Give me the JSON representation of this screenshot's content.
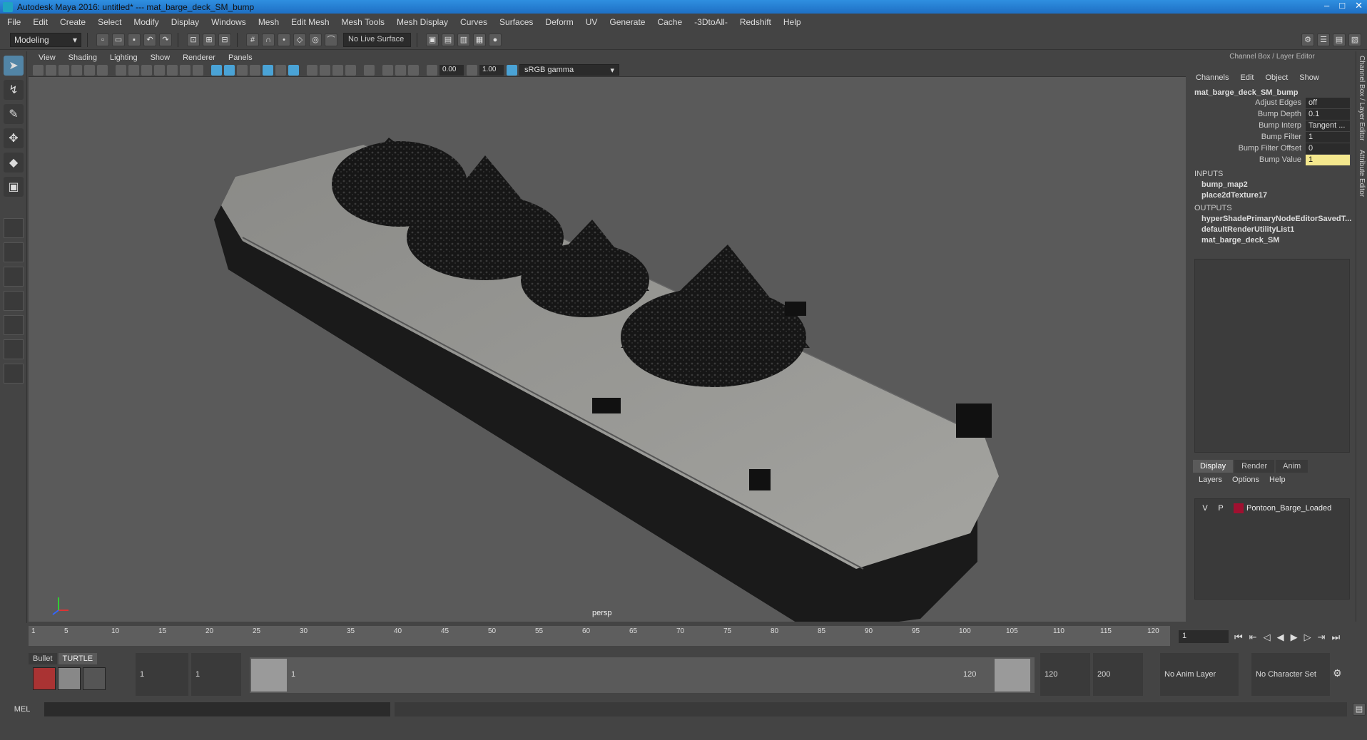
{
  "window": {
    "title": "Autodesk Maya 2016: untitled*   ---   mat_barge_deck_SM_bump",
    "min": "–",
    "max": "□",
    "close": "✕"
  },
  "menu": [
    "File",
    "Edit",
    "Create",
    "Select",
    "Modify",
    "Display",
    "Windows",
    "Mesh",
    "Edit Mesh",
    "Mesh Tools",
    "Mesh Display",
    "Curves",
    "Surfaces",
    "Deform",
    "UV",
    "Generate",
    "Cache",
    "-3DtoAll-",
    "Redshift",
    "Help"
  ],
  "statusline": {
    "mode": "Modeling",
    "live_surface": "No Live Surface"
  },
  "panel": {
    "menu": [
      "View",
      "Shading",
      "Lighting",
      "Show",
      "Renderer",
      "Panels"
    ],
    "near_value": "0.00",
    "far_value": "1.00",
    "color_space": "sRGB gamma",
    "camera_label": "persp"
  },
  "channel_box": {
    "title": "Channel Box / Layer Editor",
    "menu": [
      "Channels",
      "Edit",
      "Object",
      "Show"
    ],
    "node": "mat_barge_deck_SM_bump",
    "attributes": [
      {
        "label": "Adjust Edges",
        "value": "off"
      },
      {
        "label": "Bump Depth",
        "value": "0.1"
      },
      {
        "label": "Bump Interp",
        "value": "Tangent ..."
      },
      {
        "label": "Bump Filter",
        "value": "1"
      },
      {
        "label": "Bump Filter Offset",
        "value": "0"
      },
      {
        "label": "Bump Value",
        "value": "1"
      }
    ],
    "inputs_label": "INPUTS",
    "inputs": [
      "bump_map2",
      "place2dTexture17"
    ],
    "outputs_label": "OUTPUTS",
    "outputs": [
      "hyperShadePrimaryNodeEditorSavedT...",
      "defaultRenderUtilityList1",
      "mat_barge_deck_SM"
    ]
  },
  "layer_editor": {
    "tabs": [
      "Display",
      "Render",
      "Anim"
    ],
    "menu": [
      "Layers",
      "Options",
      "Help"
    ],
    "layer": {
      "v": "V",
      "p": "P",
      "name": "Pontoon_Barge_Loaded",
      "color": "#a01030"
    }
  },
  "side_tabs": [
    "Channel Box / Layer Editor",
    "Attribute Editor"
  ],
  "timeline": {
    "ticks": [
      "1",
      "5",
      "10",
      "15",
      "20",
      "25",
      "30",
      "35",
      "40",
      "45",
      "50",
      "55",
      "60",
      "65",
      "70",
      "75",
      "80",
      "85",
      "90",
      "95",
      "100",
      "105",
      "110",
      "115",
      "120"
    ],
    "current_frame": "1"
  },
  "range": {
    "shelf_tabs": [
      "Bullet",
      "TURTLE"
    ],
    "start_min": "1",
    "start": "1",
    "range_start_label": "1",
    "range_end_label": "120",
    "end": "120",
    "end_max": "200",
    "anim_layer": "No Anim Layer",
    "character_set": "No Character Set"
  },
  "command": {
    "label": "MEL"
  }
}
